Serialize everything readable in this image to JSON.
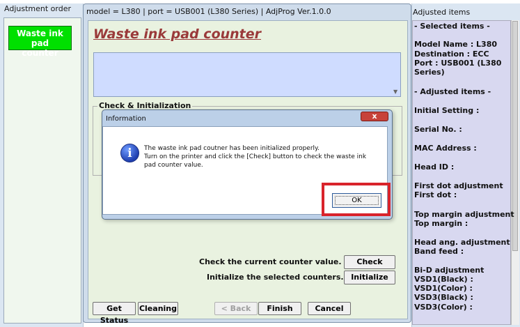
{
  "left_panel": {
    "title": "Adjustment order",
    "items": [
      {
        "label_line1": "Waste ink pad",
        "label_line2": "counter",
        "color": "#00e000"
      }
    ]
  },
  "main_window": {
    "title": "model = L380 | port = USB001 (L380 Series) | AdjProg Ver.1.0.0",
    "heading": "Waste ink pad counter",
    "group_label": "Check & Initialization",
    "check_text": "Check the current counter value. -->",
    "check_button": "Check",
    "init_text": "Initialize the selected counters. -->",
    "init_button": "Initialize",
    "bottom_buttons": {
      "get_status": "Get Status",
      "cleaning": "Cleaning",
      "back": "< Back",
      "finish": "Finish",
      "cancel": "Cancel"
    }
  },
  "dialog": {
    "title": "Information",
    "close_label": "x",
    "icon": "info-icon",
    "icon_glyph": "i",
    "message_lines": [
      "The waste ink pad coutner has been initialized properly.",
      "Turn on the printer and click the [Check] button to check the waste ink",
      "pad counter value."
    ],
    "ok_button": "OK",
    "highlight_color": "#d9232b"
  },
  "right_panel": {
    "title": "Adjusted items",
    "lines": [
      "- Selected items -",
      "Model Name : L380",
      "Destination : ECC",
      "Port : USB001 (L380",
      "Series)",
      "- Adjusted items -",
      "Initial Setting :",
      "Serial No. :",
      "MAC Address :",
      "Head ID :",
      "First dot adjustment",
      " First dot :",
      "Top margin adjustment",
      " Top margin :",
      "Head ang. adjustment",
      " Band feed :",
      "Bi-D adjustment",
      " VSD1(Black) :",
      " VSD1(Color) :",
      " VSD3(Black) :",
      " VSD3(Color) :"
    ]
  }
}
